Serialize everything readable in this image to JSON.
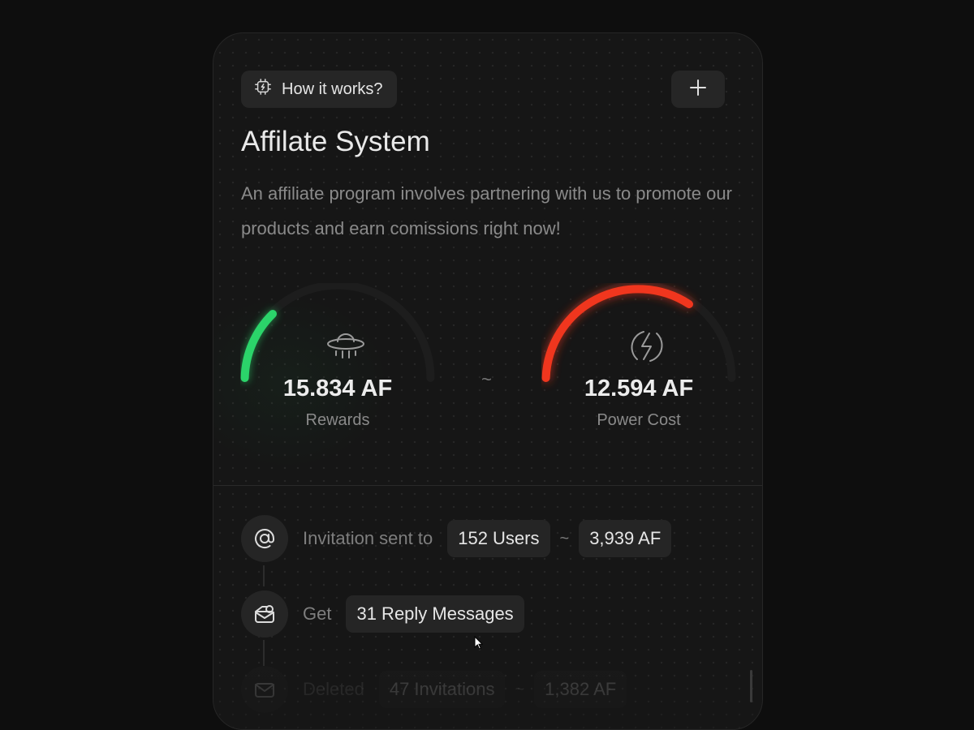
{
  "header": {
    "how_it_works_label": "How it works?",
    "how_icon": "chip-bolt-icon",
    "add_icon": "plus-icon"
  },
  "title": "Affilate System",
  "description": "An affiliate program involves partnering with us to promote our products and earn comissions right now!",
  "gauges": {
    "rewards": {
      "value": "15.834 AF",
      "label": "Rewards",
      "icon": "ufo-icon",
      "color": "#2bd46a",
      "fill_fraction": 0.12
    },
    "separator": "~",
    "power": {
      "value": "12.594 AF",
      "label": "Power Cost",
      "icon": "lightning-icon",
      "color": "#f0361e",
      "fill_fraction": 0.33
    }
  },
  "timeline": [
    {
      "icon": "at-sign-icon",
      "text": "Invitation sent to",
      "chip1": "152 Users",
      "tilde": "~",
      "chip2": "3,939 AF"
    },
    {
      "icon": "mail-reply-icon",
      "text": "Get",
      "chip1": "31 Reply Messages"
    },
    {
      "icon": "mail-icon",
      "text": "Deleted",
      "chip1": "47 Invitations",
      "tilde": "~",
      "chip2": "1,382 AF"
    }
  ]
}
